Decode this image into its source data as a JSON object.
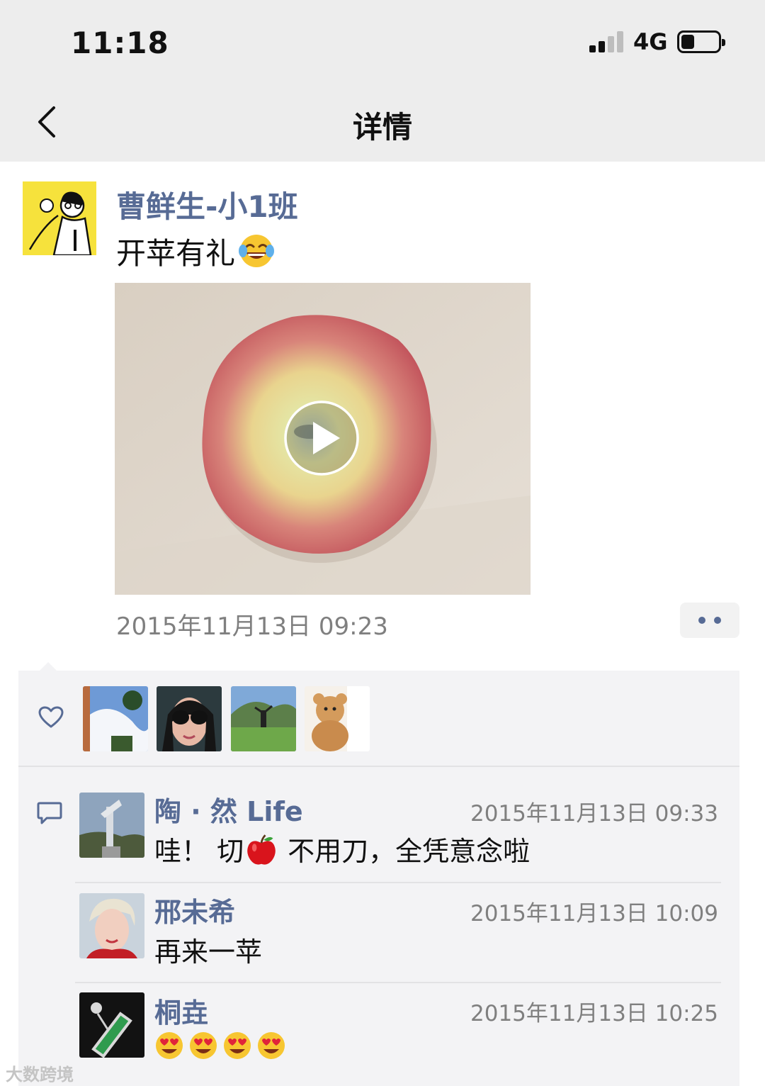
{
  "status_bar": {
    "time": "11:18",
    "network": "4G"
  },
  "nav": {
    "title": "详情"
  },
  "post": {
    "author": "曹鲜生-小1班",
    "text": "开苹有礼",
    "timestamp": "2015年11月13日 09:23"
  },
  "comments": [
    {
      "name": "陶 · 然  Life",
      "time": "2015年11月13日 09:33",
      "text_before": "哇！ 切",
      "text_after": " 不用刀，全凭意念啦"
    },
    {
      "name": "邢未希",
      "time": "2015年11月13日 10:09",
      "text": "再来一苹"
    },
    {
      "name": "桐垚",
      "time": "2015年11月13日 10:25"
    }
  ],
  "watermark": "大数跨境",
  "icons": {
    "back": "chevron-left-icon",
    "like": "heart-outline-icon",
    "comment": "speech-bubble-icon",
    "play": "play-icon",
    "more": "more-dots-icon"
  },
  "colors": {
    "link_blue": "#576b95",
    "nav_bg": "#ededed",
    "panel_bg": "#f3f3f5"
  }
}
